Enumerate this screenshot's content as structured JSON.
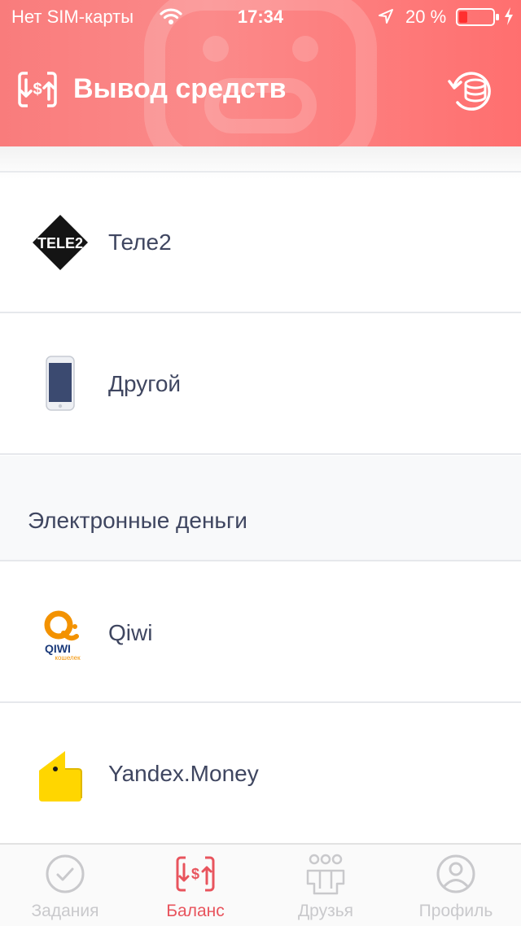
{
  "status_bar": {
    "carrier": "Нет SIM-карты",
    "time": "17:34",
    "battery": "20 %"
  },
  "header": {
    "title": "Вывод средств",
    "gradient_start": "#f97c7c",
    "gradient_end": "#ff6f6f"
  },
  "items": [
    {
      "label": "Теле2",
      "icon": "tele2-logo"
    },
    {
      "label": "Другой",
      "icon": "phone-icon"
    }
  ],
  "section": {
    "title": "Электронные деньги"
  },
  "emoney_items": [
    {
      "label": "Qiwi",
      "icon": "qiwi-logo",
      "logo_text": "QIWI",
      "logo_subtext": "кошелек"
    },
    {
      "label": "Yandex.Money",
      "icon": "yandex-money-logo"
    }
  ],
  "tabbar": {
    "tabs": [
      {
        "label": "Задания",
        "icon": "check-circle-icon",
        "active": false
      },
      {
        "label": "Баланс",
        "icon": "balance-icon",
        "active": true
      },
      {
        "label": "Друзья",
        "icon": "friends-icon",
        "active": false
      },
      {
        "label": "Профиль",
        "icon": "profile-icon",
        "active": false
      }
    ],
    "active_color": "#e8545d",
    "inactive_color": "#c9c9cc"
  }
}
